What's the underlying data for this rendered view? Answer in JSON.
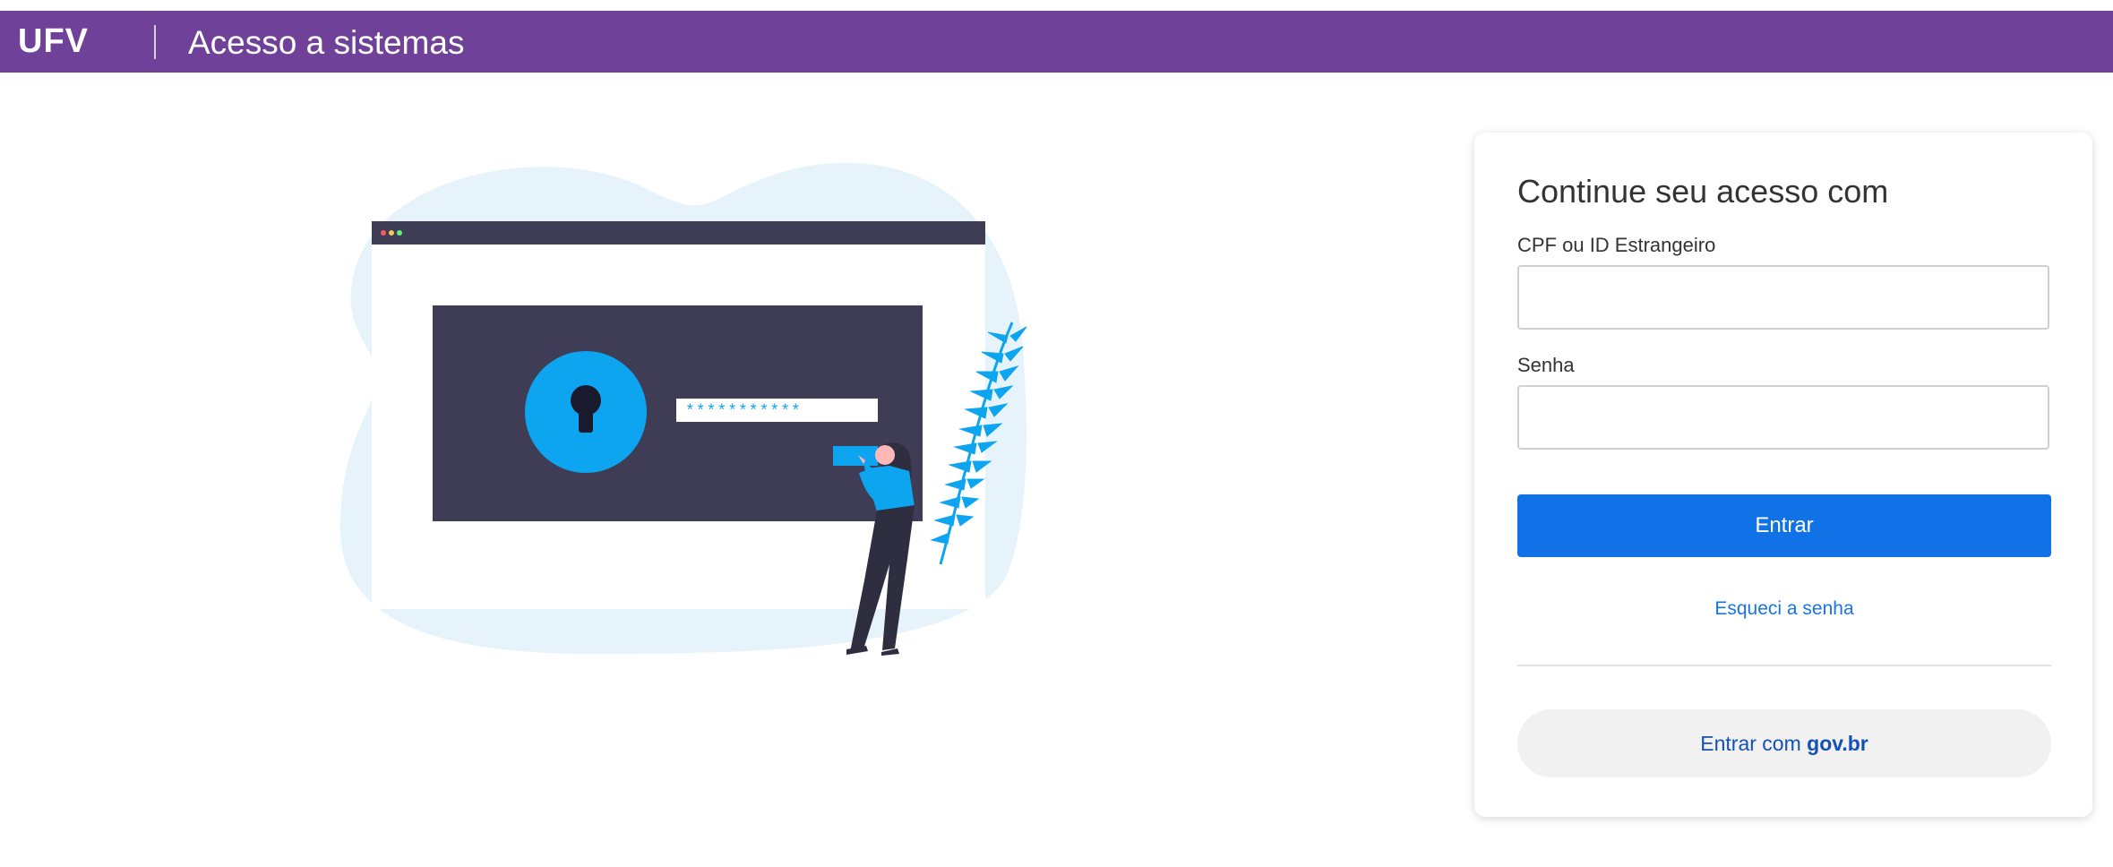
{
  "header": {
    "brand": "UFV",
    "title": "Acesso a sistemas",
    "background_color": "#6f4199"
  },
  "illustration": {
    "password_mask": "***********"
  },
  "login_card": {
    "title": "Continue seu acesso com",
    "cpf_label": "CPF ou ID Estrangeiro",
    "cpf_value": "",
    "password_label": "Senha",
    "password_value": "",
    "submit_label": "Entrar",
    "forgot_link": "Esqueci a senha",
    "govbr_prefix": "Entrar com",
    "govbr_brand": "gov.br",
    "primary_color": "#1072e6",
    "link_color": "#1a73e8"
  }
}
